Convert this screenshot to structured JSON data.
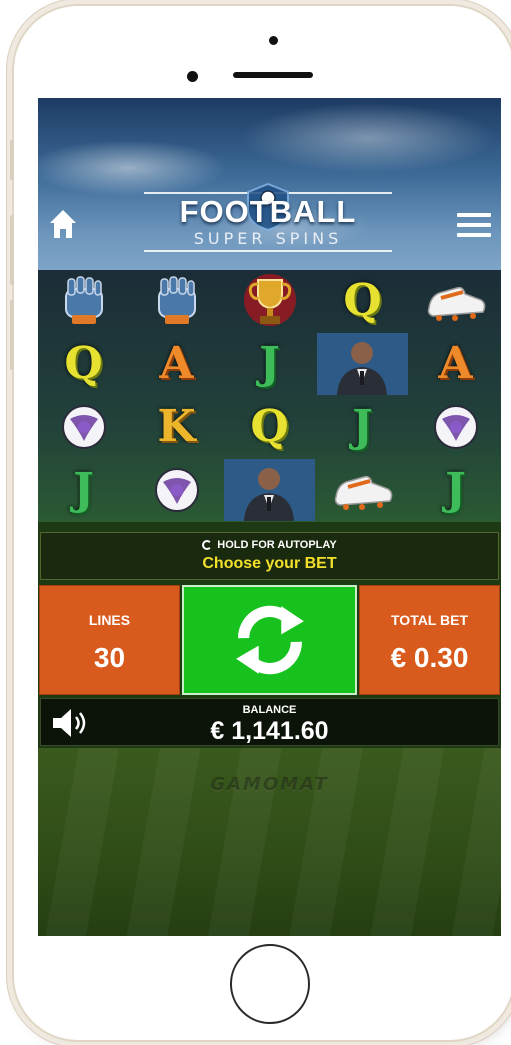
{
  "game": {
    "logo_line1": "FOOTBALL",
    "logo_line2": "SUPER SPINS"
  },
  "reels": {
    "rows": [
      [
        "glove-icon",
        "glove-icon",
        "trophy-icon",
        "Q",
        "boot-icon"
      ],
      [
        "Q",
        "A",
        "J",
        "coach-icon",
        "A"
      ],
      [
        "ball-icon",
        "K",
        "Q",
        "J",
        "ball-icon"
      ],
      [
        "J",
        "ball-icon",
        "coach-icon",
        "boot-icon",
        "J"
      ]
    ]
  },
  "panel": {
    "autoplay_hint": "HOLD FOR AUTOPLAY",
    "status": "Choose your BET"
  },
  "lines": {
    "label": "LINES",
    "value": "30"
  },
  "total_bet": {
    "label": "TOTAL BET",
    "value": "€ 0.30"
  },
  "balance": {
    "label": "BALANCE",
    "value": "€ 1,141.60"
  },
  "brand": "GAMOMAT",
  "colors": {
    "bet_box": "#d85a1c",
    "spin_button": "#17c21e",
    "status_text": "#f3e02c"
  }
}
